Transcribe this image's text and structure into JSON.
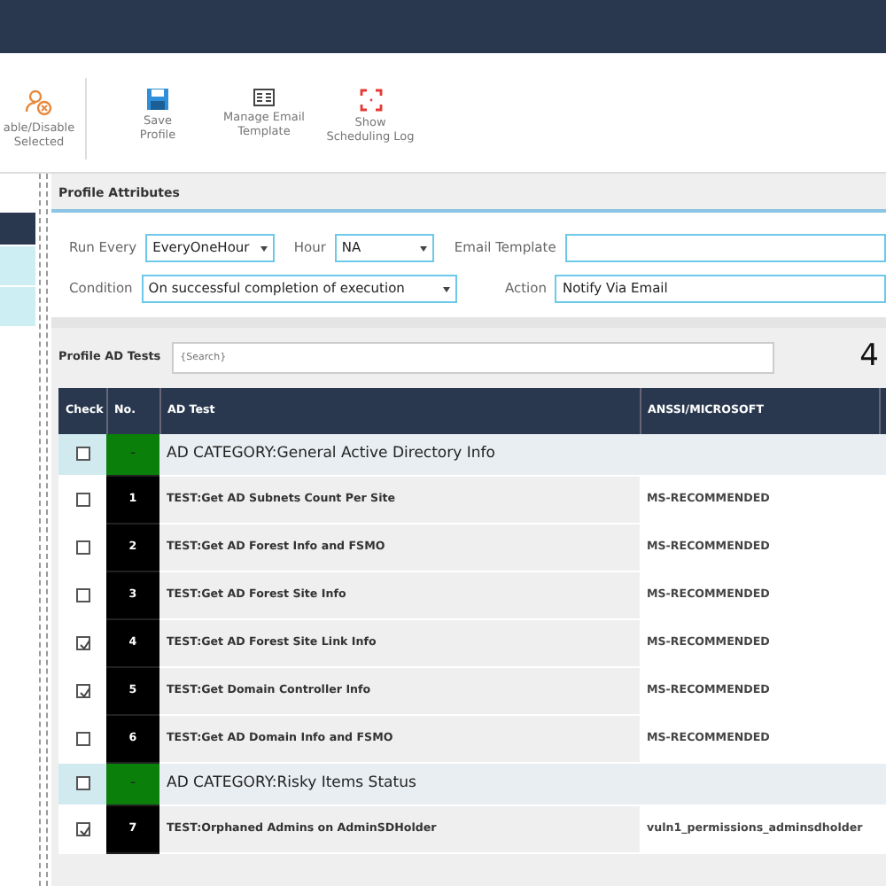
{
  "toolbar": {
    "buttons": [
      {
        "kind": "enable",
        "label": "able/Disable\nSelected"
      },
      {
        "kind": "save",
        "label": "Save\nProfile"
      },
      {
        "kind": "email",
        "label": "Manage Email\nTemplate"
      },
      {
        "kind": "log",
        "label": "Show\nScheduling Log"
      }
    ]
  },
  "sidebar": {
    "items": [
      {
        "selected": true
      },
      {
        "selected": false
      },
      {
        "selected": false
      }
    ]
  },
  "profile_attributes": {
    "title": "Profile Attributes",
    "run_every": {
      "label": "Run Every",
      "value": "EveryOneHour"
    },
    "hour": {
      "label": "Hour",
      "value": "NA"
    },
    "email_template": {
      "label": "Email Template"
    },
    "condition": {
      "label": "Condition",
      "value": "On successful completion of execution"
    },
    "action": {
      "label": "Action",
      "value": "Notify Via Email"
    }
  },
  "tests": {
    "title": "Profile AD Tests",
    "search": {
      "placeholder": "{Search}"
    },
    "count": "4",
    "columns": [
      "Check",
      "No.",
      "AD Test",
      "ANSSI/MICROSOFT"
    ],
    "rows": [
      {
        "kind": "category",
        "checked": false,
        "no": "-",
        "name": "AD CATEGORY:General Active Directory Info"
      },
      {
        "kind": "test",
        "checked": false,
        "no": "1",
        "name": "TEST:Get AD Subnets Count Per Site",
        "source": "MS-RECOMMENDED"
      },
      {
        "kind": "test",
        "checked": false,
        "no": "2",
        "name": "TEST:Get AD Forest Info and FSMO",
        "source": "MS-RECOMMENDED"
      },
      {
        "kind": "test",
        "checked": false,
        "no": "3",
        "name": "TEST:Get AD Forest Site Info",
        "source": "MS-RECOMMENDED"
      },
      {
        "kind": "test",
        "checked": true,
        "no": "4",
        "name": "TEST:Get AD Forest Site Link Info",
        "source": "MS-RECOMMENDED"
      },
      {
        "kind": "test",
        "checked": true,
        "no": "5",
        "name": "TEST:Get Domain Controller Info",
        "source": "MS-RECOMMENDED"
      },
      {
        "kind": "test",
        "checked": false,
        "no": "6",
        "name": "TEST:Get AD Domain Info and FSMO",
        "source": "MS-RECOMMENDED"
      },
      {
        "kind": "category",
        "checked": false,
        "no": "-",
        "name": "AD CATEGORY:Risky Items Status"
      },
      {
        "kind": "test",
        "checked": true,
        "no": "7",
        "name": "TEST:Orphaned Admins on AdminSDHolder",
        "source": "vuln1_permissions_adminsdholder"
      }
    ]
  }
}
